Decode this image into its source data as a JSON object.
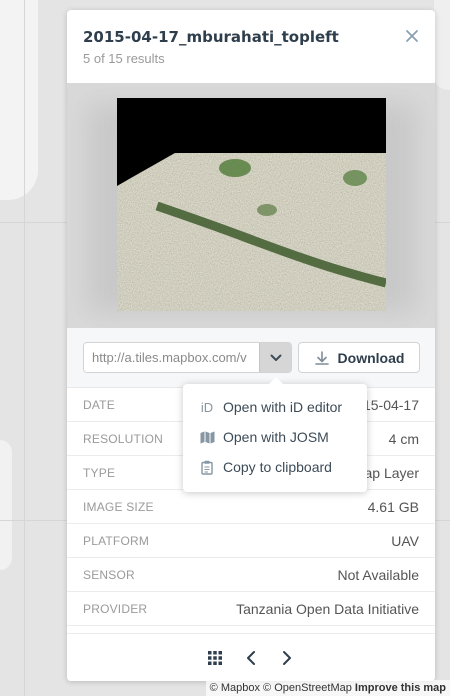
{
  "attribution": {
    "mapbox": "© Mapbox",
    "osm": "© OpenStreetMap",
    "improve": "Improve this map"
  },
  "panel": {
    "title": "2015-04-17_mburahati_topleft",
    "subtitle": "5 of 15 results",
    "close_icon": "close-icon",
    "url_value": "http://a.tiles.mapbox.com/v",
    "download_label": "Download"
  },
  "dropdown": {
    "items": [
      {
        "icon_text": "iD",
        "label": "Open with iD editor"
      },
      {
        "icon_text": "",
        "label": "Open with JOSM"
      },
      {
        "icon_text": "",
        "label": "Copy to clipboard"
      }
    ]
  },
  "meta": [
    {
      "label": "Date",
      "value": "15-04-17"
    },
    {
      "label": "Resolution",
      "value": "4 cm"
    },
    {
      "label": "Type",
      "value": "ap Layer"
    },
    {
      "label": "Image Size",
      "value": "4.61 GB"
    },
    {
      "label": "Platform",
      "value": "UAV"
    },
    {
      "label": "Sensor",
      "value": "Not Available"
    },
    {
      "label": "Provider",
      "value": "Tanzania Open Data Initiative"
    }
  ],
  "colors": {
    "title": "#2f3e4c",
    "accent_close": "#8aa0b0",
    "muted": "#9a9a9a"
  }
}
